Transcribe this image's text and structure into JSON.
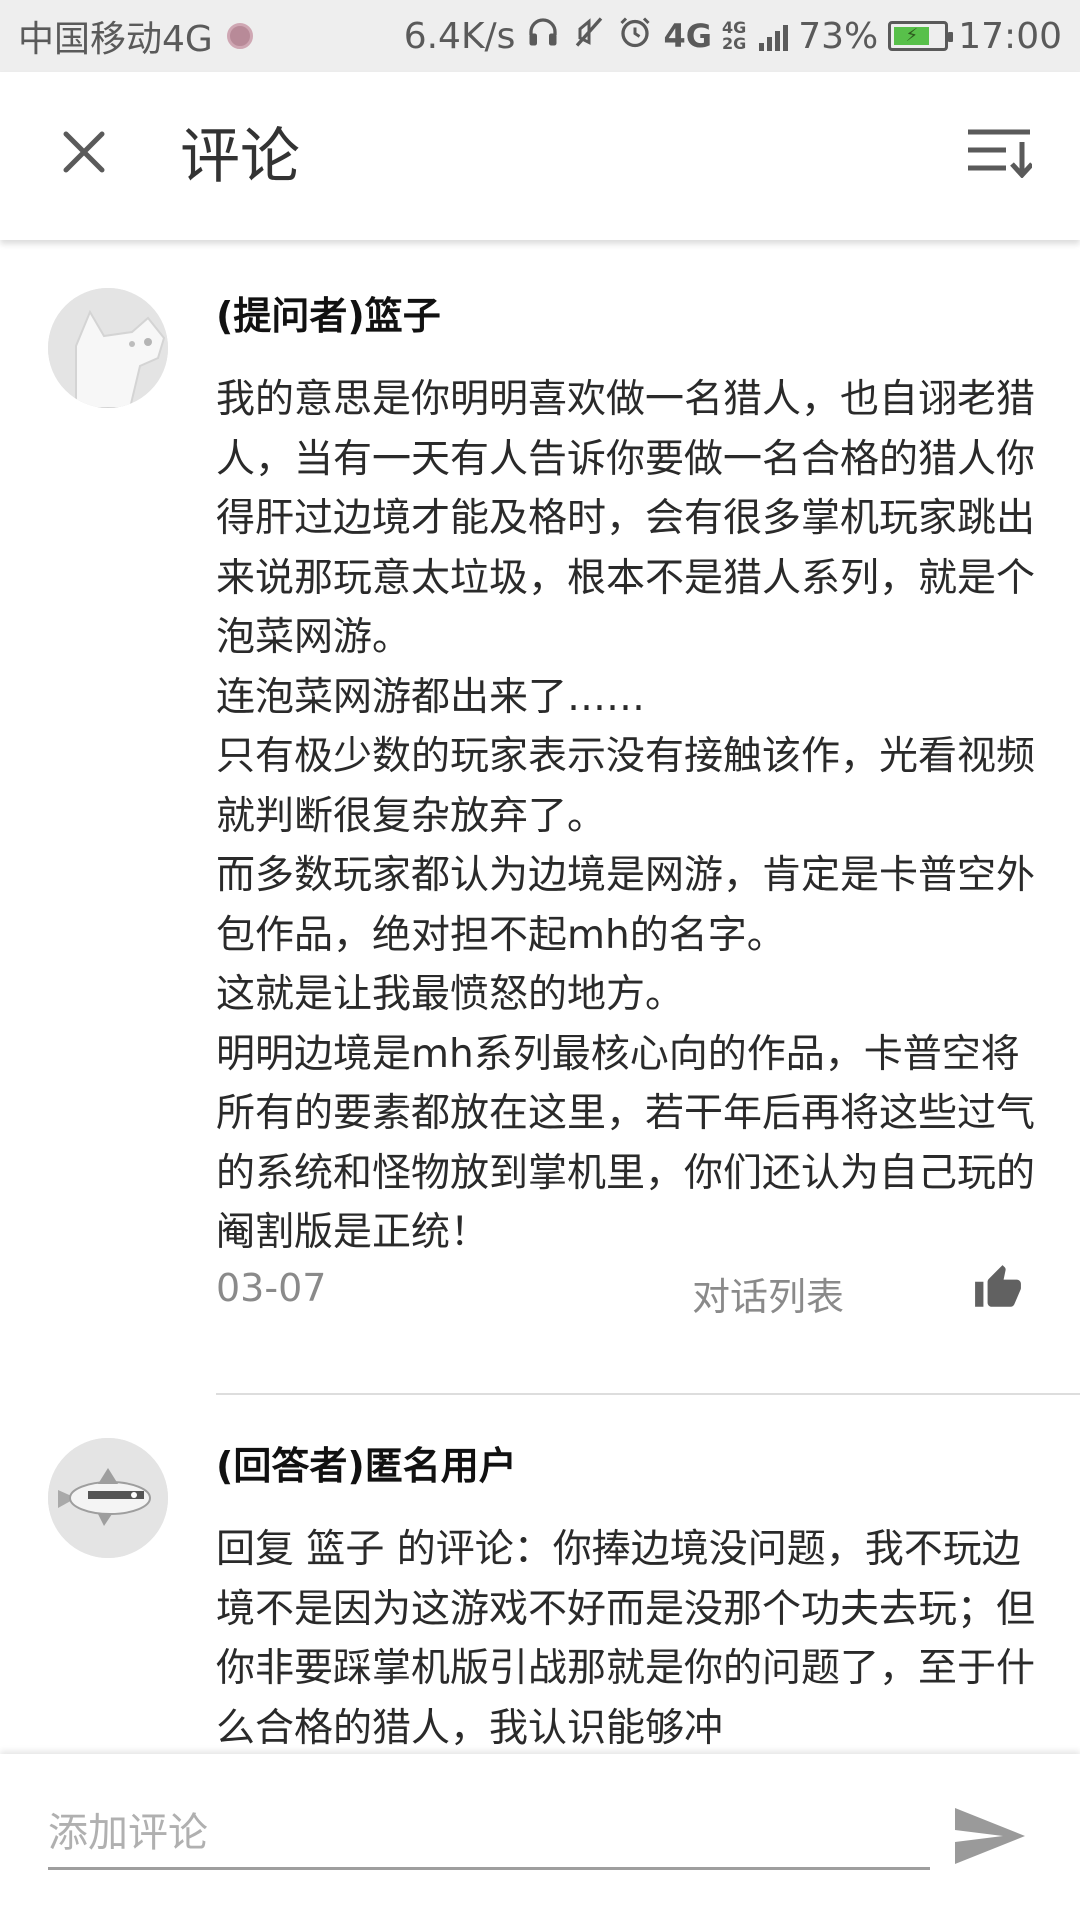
{
  "status_bar": {
    "carrier": "中国移动4G",
    "speed": "6.4K/s",
    "net_4g": "4G",
    "net_4g_small": "4G",
    "net_2g_small": "2G",
    "battery": "73%",
    "battery_level": 0.73,
    "time": "17:00",
    "icons": [
      "headset-icon",
      "mute-icon",
      "alarm-icon",
      "signal-icon",
      "battery-icon"
    ]
  },
  "header": {
    "title": "评论",
    "close_icon": "close-icon",
    "sort_icon": "sort-icon"
  },
  "comments": [
    {
      "author": "(提问者)篮子",
      "text": "我的意思是你明明喜欢做一名猎人，也自诩老猎人，当有一天有人告诉你要做一名合格的猎人你得肝过边境才能及格时，会有很多掌机玩家跳出来说那玩意太垃圾，根本不是猎人系列，就是个泡菜网游。\n连泡菜网游都出来了……\n只有极少数的玩家表示没有接触该作，光看视频就判断很复杂放弃了。\n而多数玩家都认为边境是网游，肯定是卡普空外包作品，绝对担不起mh的名字。\n这就是让我最愤怒的地方。\n明明边境是mh系列最核心向的作品，卡普空将所有的要素都放在这里，若干年后再将这些过气的系统和怪物放到掌机里，你们还认为自己玩的阉割版是正统！",
      "date": "03-07",
      "conversation_link": "对话列表",
      "like_icon": "thumbs-up-icon"
    },
    {
      "author": "(回答者)匿名用户",
      "text": "回复 篮子 的评论：你捧边境没问题，我不玩边境不是因为这游戏不好而是没那个功夫去玩；但你非要踩掌机版引战那就是你的问题了，至于什么合格的猎人，我认识能够冲"
    }
  ],
  "footer": {
    "input_placeholder": "添加评论",
    "send_icon": "send-icon"
  },
  "colors": {
    "status_bar_bg": "#eeeeee",
    "battery_fill": "#58c04a",
    "meta_text": "#8a8a8a",
    "icon_gray": "#5f5f5f"
  }
}
